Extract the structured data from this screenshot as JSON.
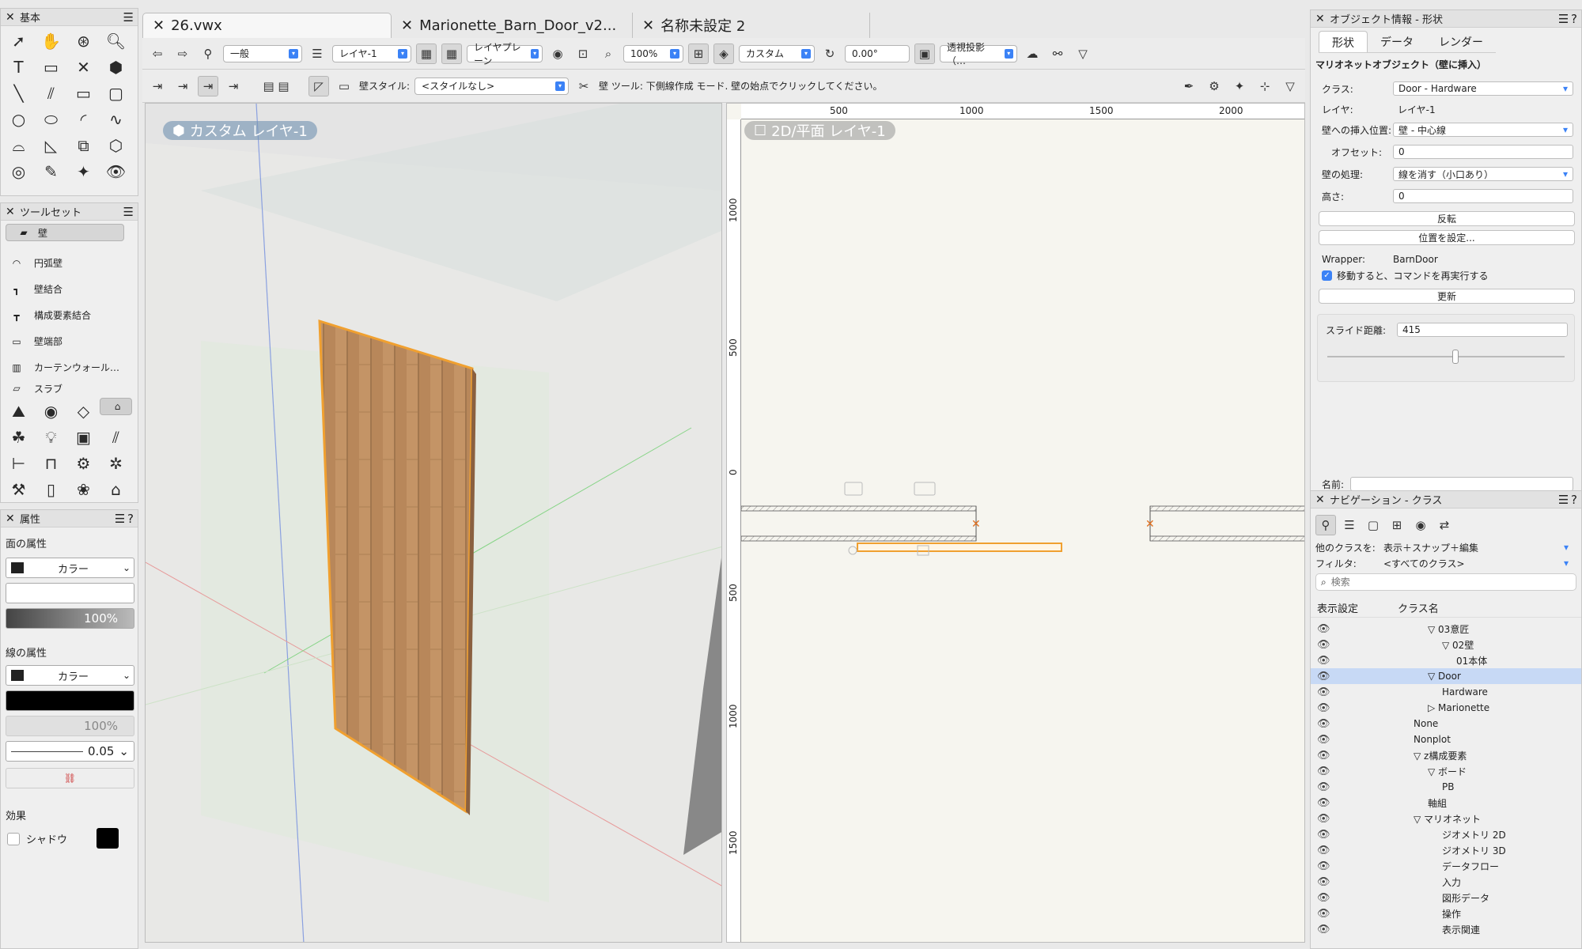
{
  "left": {
    "basic_title": "基本",
    "toolset_title": "ツールセット",
    "toolset_items": [
      "壁",
      "円弧壁",
      "壁結合",
      "構成要素結合",
      "壁端部",
      "カーテンウォール…",
      "スラブ"
    ],
    "attr_title": "属性",
    "fill_label": "面の属性",
    "fill_mode": "カラー",
    "fill_opacity": "100%",
    "line_label": "線の属性",
    "line_mode": "カラー",
    "line_opacity": "100%",
    "line_weight": "0.05",
    "effect_label": "効果",
    "shadow_label": "シャドウ"
  },
  "tabs": [
    "26.vwx",
    "Marionette_Barn_Door_v2...",
    "名称未設定 2"
  ],
  "toolbar": {
    "class": "一般",
    "layer": "レイヤ-1",
    "plane": "レイヤプレーン",
    "zoom": "100%",
    "view": "カスタム",
    "angle": "0.00°",
    "projection": "透視投影（…",
    "wall_style_label": "壁スタイル:",
    "wall_style": "<スタイルなし>",
    "hint": "壁 ツール: 下側線作成 モード. 壁の始点でクリックしてください。"
  },
  "viewport3d": {
    "label": "カスタム  レイヤ-1"
  },
  "viewport2d": {
    "label": "2D/平面  レイヤ-1",
    "ruler_h": [
      "500",
      "1000",
      "1500",
      "2000"
    ],
    "ruler_v": [
      "1000",
      "500",
      "0",
      "500",
      "1000",
      "1500"
    ]
  },
  "objinfo": {
    "title": "オブジェクト情報 - 形状",
    "tabs": [
      "形状",
      "データ",
      "レンダー"
    ],
    "heading": "マリオネットオブジェクト（壁に挿入）",
    "class_label": "クラス:",
    "class_value": "Door - Hardware",
    "layer_label": "レイヤ:",
    "layer_value": "レイヤ-1",
    "insert_label": "壁への挿入位置:",
    "insert_value": "壁 - 中心線",
    "offset_label": "オフセット:",
    "offset_value": "0",
    "treat_label": "壁の処理:",
    "treat_value": "線を消す（小口あり）",
    "height_label": "高さ:",
    "height_value": "0",
    "flip_btn": "反転",
    "position_btn": "位置を設定...",
    "wrapper_label": "Wrapper:",
    "wrapper_value": "BarnDoor",
    "rerun_label": "移動すると、コマンドを再実行する",
    "update_btn": "更新",
    "slide_label": "スライド距離:",
    "slide_value": "415",
    "name_label": "名前:"
  },
  "nav": {
    "title": "ナビゲーション - クラス",
    "other_class_label": "他のクラスを:",
    "other_class_value": "表示＋スナップ＋編集",
    "filter_label": "フィルタ:",
    "filter_value": "<すべてのクラス>",
    "search_placeholder": "検索",
    "col_vis": "表示設定",
    "col_name": "クラス名",
    "rows": [
      {
        "name": "▽ 03意匠",
        "indent": 1
      },
      {
        "name": "▽ 02壁",
        "indent": 2
      },
      {
        "name": "01本体",
        "indent": 3
      },
      {
        "name": "▽ Door",
        "indent": 1
      },
      {
        "name": "Hardware",
        "indent": 2
      },
      {
        "name": "▷ Marionette",
        "indent": 1
      },
      {
        "name": "None",
        "indent": 0
      },
      {
        "name": "Nonplot",
        "indent": 0
      },
      {
        "name": "▽ z構成要素",
        "indent": 0
      },
      {
        "name": "▽ ボード",
        "indent": 1
      },
      {
        "name": "PB",
        "indent": 2
      },
      {
        "name": "軸組",
        "indent": 1
      },
      {
        "name": "▽ マリオネット",
        "indent": 0
      },
      {
        "name": "ジオメトリ 2D",
        "indent": 2
      },
      {
        "name": "ジオメトリ 3D",
        "indent": 2
      },
      {
        "name": "データフロー",
        "indent": 2
      },
      {
        "name": "入力",
        "indent": 2
      },
      {
        "name": "図形データ",
        "indent": 2
      },
      {
        "name": "操作",
        "indent": 2
      },
      {
        "name": "表示関連",
        "indent": 2
      }
    ],
    "highlight_index": 3
  },
  "colors": {
    "accent": "#3b82f6",
    "selection": "#c7d9f5",
    "door_outline": "#f0a030"
  }
}
